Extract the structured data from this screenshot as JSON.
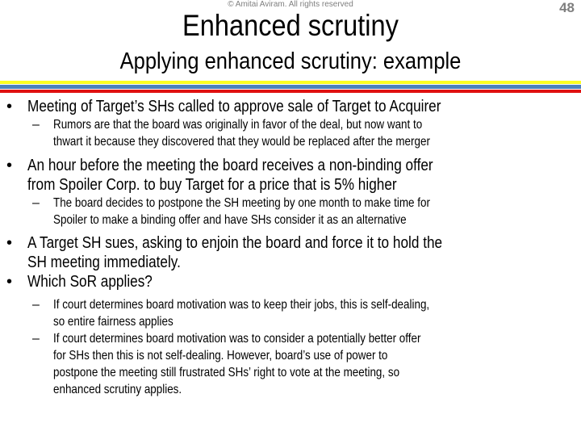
{
  "header": {
    "copyright": "© Amitai Aviram.  All rights reserved",
    "page_number": "48",
    "title": "Enhanced scrutiny",
    "subtitle": "Applying enhanced scrutiny: example"
  },
  "colors": {
    "stripe_yellow": "#ffff22",
    "stripe_blue": "#4f81bd",
    "stripe_red": "#e01010",
    "meta_gray": "#7f7f7f"
  },
  "bullets": [
    {
      "lines": [
        "Meeting of Target’s SHs called to approve sale of Target to Acquirer"
      ],
      "sub": [
        {
          "lines": [
            "Rumors are that the board was originally in favor of the deal, but now want to",
            "thwart it because they discovered that they would be replaced after the merger"
          ]
        }
      ]
    },
    {
      "lines": [
        "An hour before the meeting the board receives a non-binding offer",
        "from Spoiler Corp. to buy Target for a price that is 5% higher"
      ],
      "sub": [
        {
          "lines": [
            "The board decides to postpone the SH meeting by one month to make time for",
            "Spoiler to make a binding offer and have SHs consider it as an alternative"
          ]
        }
      ]
    },
    {
      "lines": [
        "A Target SH sues, asking to enjoin the board and force it to hold the",
        "SH meeting immediately."
      ],
      "sub": []
    },
    {
      "lines": [
        "Which SoR applies?"
      ],
      "sub": [
        {
          "lines": [
            "If court determines board motivation was to keep their jobs, this is self-dealing,",
            "so entire fairness applies"
          ]
        },
        {
          "lines": [
            "If court determines board motivation was to consider a potentially better offer",
            "for SHs then this is not self-dealing. However, board’s use of power to",
            "postpone the meeting still frustrated SHs’ right to vote at the meeting, so",
            "enhanced scrutiny applies."
          ]
        }
      ]
    }
  ],
  "glyphs": {
    "bullet": "•",
    "dash": "–"
  }
}
